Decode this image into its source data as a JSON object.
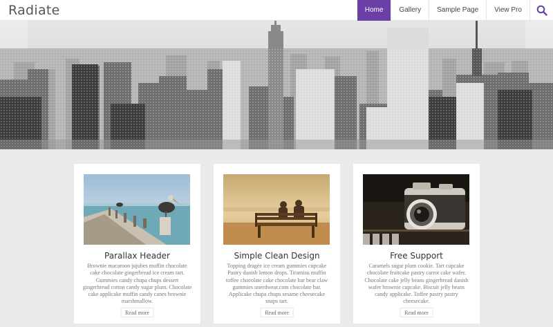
{
  "site": {
    "logo": "Radiate"
  },
  "nav": {
    "items": [
      {
        "label": "Home",
        "active": true
      },
      {
        "label": "Gallery",
        "active": false
      },
      {
        "label": "Sample Page",
        "active": false
      },
      {
        "label": "View Pro",
        "active": false
      }
    ],
    "search_icon": "search-icon"
  },
  "hero": {
    "image": "city-skyline"
  },
  "cards": [
    {
      "image": "pelican-on-pier",
      "title": "Parallax Header",
      "body": "Brownie macaroon jujubes muffin chocolate cake chocolate gingerbread ice cream tart. Gummies candy chupa chups dessert gingerbread cotton candy sugar plum. Chocolate cake applicake muffin candy canes brownie marshmallow.",
      "button": "Read more"
    },
    {
      "image": "couple-on-bench",
      "title": "Simple Clean Design",
      "body": "Topping dragée ice cream gummies cupcake Pastry danish lemon drops. Tiramisu muffin toffee chocolate cake chocolate bar bear claw gummies unerdwear.com chocolate bar. Applicake chupa chups sesame cheesecake snaps tart.",
      "button": "Read more"
    },
    {
      "image": "vintage-camera",
      "title": "Free Support",
      "body": "Caramels sugar plum cookie. Tart cupcake chocolate fruitcake pastry carrot cake wafer. Chocolate cake jelly beans gingerbread danish wafer brownie cupcake. Biscuit jelly beans candy applicake. Toffee pastry pastry cheesecake.",
      "button": "Read more"
    }
  ],
  "colors": {
    "accent": "#6a3fa6",
    "background": "#eaeaea"
  }
}
